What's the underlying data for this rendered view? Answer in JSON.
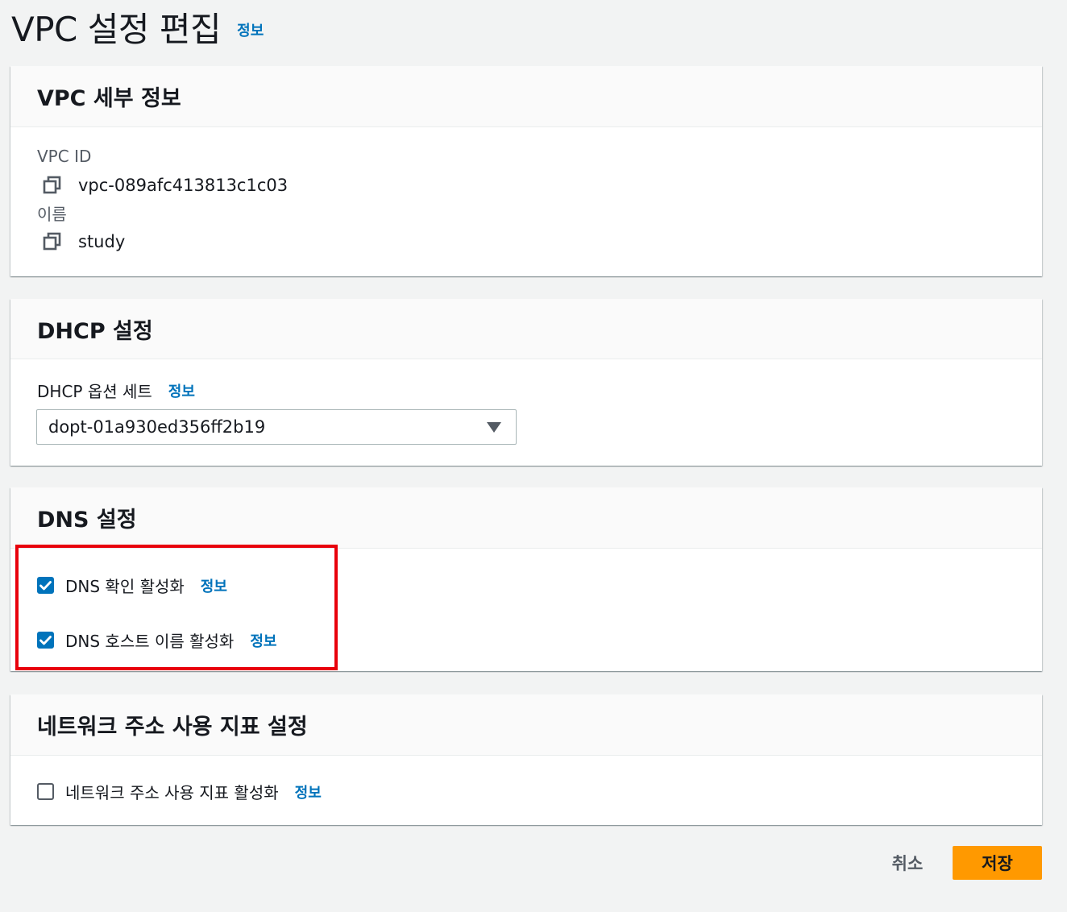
{
  "page": {
    "title": "VPC 설정 편집",
    "info_label": "정보"
  },
  "vpc_details": {
    "title": "VPC 세부 정보",
    "vpc_id_label": "VPC ID",
    "vpc_id_value": "vpc-089afc413813c1c03",
    "name_label": "이름",
    "name_value": "study"
  },
  "dhcp": {
    "title": "DHCP 설정",
    "option_set_label": "DHCP 옵션 세트",
    "info_label": "정보",
    "selected_value": "dopt-01a930ed356ff2b19"
  },
  "dns": {
    "title": "DNS 설정",
    "resolution_label": "DNS 확인 활성화",
    "resolution_checked": true,
    "hostnames_label": "DNS 호스트 이름 활성화",
    "hostnames_checked": true,
    "info_label": "정보"
  },
  "network_metrics": {
    "title": "네트워크 주소 사용 지표 설정",
    "enable_label": "네트워크 주소 사용 지표 활성화",
    "enable_checked": false,
    "info_label": "정보"
  },
  "actions": {
    "cancel_label": "취소",
    "save_label": "저장"
  },
  "colors": {
    "accent": "#0073bb",
    "primary_button": "#ff9900",
    "highlight": "#e8000b",
    "background": "#f2f3f3"
  },
  "icons": {
    "copy": "copy-icon",
    "dropdown": "caret-down-icon",
    "check": "check-icon"
  }
}
